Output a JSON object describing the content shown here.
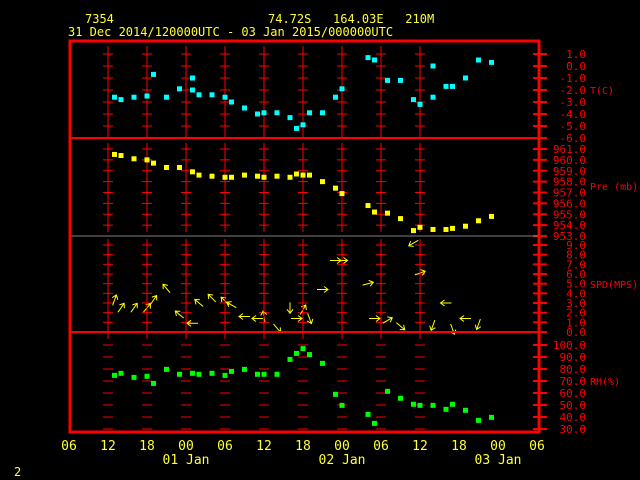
{
  "header": {
    "station_id": "7354",
    "location": "74.72S   164.03E   210M",
    "period": "31 Dec 2014/120000UTC - 03 Jan 2015/000000UTC"
  },
  "corner_label": "2",
  "colors": {
    "frame": "#ff0000",
    "text": "#ffff33",
    "temp": "#00ffff",
    "pressure": "#ffff00",
    "wind": "#ffff00",
    "rh": "#00ff00",
    "divider": "#808080"
  },
  "chart_data": [
    {
      "type": "scatter",
      "title": "T(C)",
      "ylabel": "T(C)",
      "ylim": [
        -6.0,
        1.0
      ],
      "yticks": [
        "1.0",
        "0.0",
        "-1.0",
        "-2.0",
        "-3.0",
        "-4.0",
        "-5.0",
        "-6.0"
      ],
      "x_units": "hours since 31 Dec 2014 12UTC",
      "points": [
        [
          1,
          -2.6
        ],
        [
          2,
          -2.8
        ],
        [
          4,
          -2.6
        ],
        [
          6,
          -2.5
        ],
        [
          7,
          -0.7
        ],
        [
          9,
          -2.6
        ],
        [
          11,
          -1.9
        ],
        [
          13,
          -1.0
        ],
        [
          13,
          -2.0
        ],
        [
          14,
          -2.4
        ],
        [
          16,
          -2.4
        ],
        [
          18,
          -2.6
        ],
        [
          19,
          -3.0
        ],
        [
          21,
          -3.5
        ],
        [
          23,
          -4.0
        ],
        [
          24,
          -3.9
        ],
        [
          26,
          -3.9
        ],
        [
          28,
          -4.3
        ],
        [
          29,
          -5.2
        ],
        [
          30,
          -4.9
        ],
        [
          31,
          -3.9
        ],
        [
          33,
          -3.9
        ],
        [
          35,
          -2.6
        ],
        [
          36,
          -1.9
        ],
        [
          40,
          0.7
        ],
        [
          41,
          0.5
        ],
        [
          43,
          -1.2
        ],
        [
          45,
          -1.2
        ],
        [
          47,
          -2.8
        ],
        [
          48,
          -3.2
        ],
        [
          50,
          0.0
        ],
        [
          50,
          -2.6
        ],
        [
          52,
          -1.7
        ],
        [
          53,
          -1.7
        ],
        [
          55,
          -1.0
        ],
        [
          57,
          0.5
        ],
        [
          59,
          0.3
        ]
      ]
    },
    {
      "type": "scatter",
      "title": "Pre (mb)",
      "ylabel": "Pre (mb)",
      "ylim": [
        953.0,
        961.0
      ],
      "yticks": [
        "961.0",
        "960.0",
        "959.0",
        "958.0",
        "957.0",
        "956.0",
        "955.0",
        "954.0",
        "953.0"
      ],
      "points": [
        [
          1,
          960.5
        ],
        [
          2,
          960.4
        ],
        [
          4,
          960.1
        ],
        [
          6,
          960.0
        ],
        [
          7,
          959.7
        ],
        [
          9,
          959.3
        ],
        [
          11,
          959.3
        ],
        [
          13,
          958.9
        ],
        [
          14,
          958.6
        ],
        [
          16,
          958.5
        ],
        [
          18,
          958.4
        ],
        [
          19,
          958.4
        ],
        [
          21,
          958.6
        ],
        [
          23,
          958.5
        ],
        [
          24,
          958.4
        ],
        [
          26,
          958.5
        ],
        [
          28,
          958.4
        ],
        [
          29,
          958.7
        ],
        [
          30,
          958.6
        ],
        [
          31,
          958.6
        ],
        [
          33,
          958.0
        ],
        [
          35,
          957.4
        ],
        [
          36,
          956.9
        ],
        [
          40,
          955.8
        ],
        [
          41,
          955.2
        ],
        [
          43,
          955.1
        ],
        [
          45,
          954.6
        ],
        [
          47,
          953.5
        ],
        [
          48,
          953.8
        ],
        [
          50,
          953.6
        ],
        [
          52,
          953.6
        ],
        [
          53,
          953.7
        ],
        [
          55,
          953.9
        ],
        [
          57,
          954.4
        ],
        [
          59,
          954.8
        ]
      ]
    },
    {
      "type": "scatter",
      "title": "SPD(MPS)",
      "ylabel": "SPD(MPS)",
      "ylim": [
        0.0,
        9.0
      ],
      "yticks": [
        "9.0",
        "8.0",
        "7.0",
        "6.0",
        "5.0",
        "4.0",
        "3.0",
        "2.0",
        "1.0",
        "0.0"
      ],
      "marker": "wind-arrow",
      "points": [
        [
          1,
          3.3,
          20
        ],
        [
          2,
          2.5,
          35
        ],
        [
          4,
          2.5,
          35
        ],
        [
          6,
          2.5,
          40
        ],
        [
          7,
          3.3,
          35
        ],
        [
          9,
          4.5,
          320
        ],
        [
          11,
          1.8,
          310
        ],
        [
          13,
          0.9,
          270
        ],
        [
          14,
          3.0,
          310
        ],
        [
          16,
          3.5,
          315
        ],
        [
          18,
          3.2,
          315
        ],
        [
          19,
          2.8,
          300
        ],
        [
          21,
          1.6,
          270
        ],
        [
          23,
          1.4,
          270
        ],
        [
          24,
          1.6,
          350
        ],
        [
          26,
          0.4,
          140
        ],
        [
          28,
          2.5,
          180
        ],
        [
          29,
          1.4,
          90
        ],
        [
          30,
          2.3,
          30
        ],
        [
          31,
          1.4,
          160
        ],
        [
          33,
          4.4,
          90
        ],
        [
          35,
          7.4,
          90
        ],
        [
          36,
          7.4,
          90
        ],
        [
          40,
          5.0,
          75
        ],
        [
          41,
          1.4,
          90
        ],
        [
          43,
          1.2,
          60
        ],
        [
          45,
          0.6,
          130
        ],
        [
          47,
          9.2,
          240
        ],
        [
          48,
          6.1,
          70
        ],
        [
          50,
          0.7,
          200
        ],
        [
          52,
          3.0,
          270
        ],
        [
          53,
          0.3,
          160
        ],
        [
          55,
          1.4,
          270
        ],
        [
          57,
          0.8,
          200
        ]
      ]
    },
    {
      "type": "scatter",
      "title": "RH(%)",
      "ylabel": "RH(%)",
      "ylim": [
        30.0,
        100.0
      ],
      "yticks": [
        "100.0",
        "90.0",
        "80.0",
        "70.0",
        "60.0",
        "50.0",
        "40.0",
        "30.0"
      ],
      "points": [
        [
          1,
          74.7
        ],
        [
          2,
          76.4
        ],
        [
          4,
          73.0
        ],
        [
          6,
          73.9
        ],
        [
          7,
          68.0
        ],
        [
          9,
          79.7
        ],
        [
          11,
          75.6
        ],
        [
          13,
          76.4
        ],
        [
          14,
          75.6
        ],
        [
          16,
          76.4
        ],
        [
          18,
          74.7
        ],
        [
          19,
          78.0
        ],
        [
          21,
          79.7
        ],
        [
          23,
          75.6
        ],
        [
          24,
          75.6
        ],
        [
          26,
          75.6
        ],
        [
          28,
          88.0
        ],
        [
          29,
          93.0
        ],
        [
          30,
          97.0
        ],
        [
          31,
          92.0
        ],
        [
          33,
          84.7
        ],
        [
          35,
          58.9
        ],
        [
          36,
          49.7
        ],
        [
          40,
          42.2
        ],
        [
          41,
          34.7
        ],
        [
          43,
          61.4
        ],
        [
          45,
          55.6
        ],
        [
          47,
          50.6
        ],
        [
          48,
          49.7
        ],
        [
          50,
          49.7
        ],
        [
          52,
          46.4
        ],
        [
          53,
          50.6
        ],
        [
          55,
          45.6
        ],
        [
          57,
          37.2
        ],
        [
          59,
          39.7
        ]
      ]
    }
  ],
  "x_axis": {
    "range_hours": [
      -6,
      66
    ],
    "tick_labels": [
      "06",
      "12",
      "18",
      "00",
      "06",
      "12",
      "18",
      "00",
      "06",
      "12",
      "18",
      "00",
      "06"
    ],
    "date_labels": [
      {
        "h": 12,
        "label": "01 Jan"
      },
      {
        "h": 36,
        "label": "02 Jan"
      },
      {
        "h": 60,
        "label": "03 Jan"
      }
    ]
  }
}
